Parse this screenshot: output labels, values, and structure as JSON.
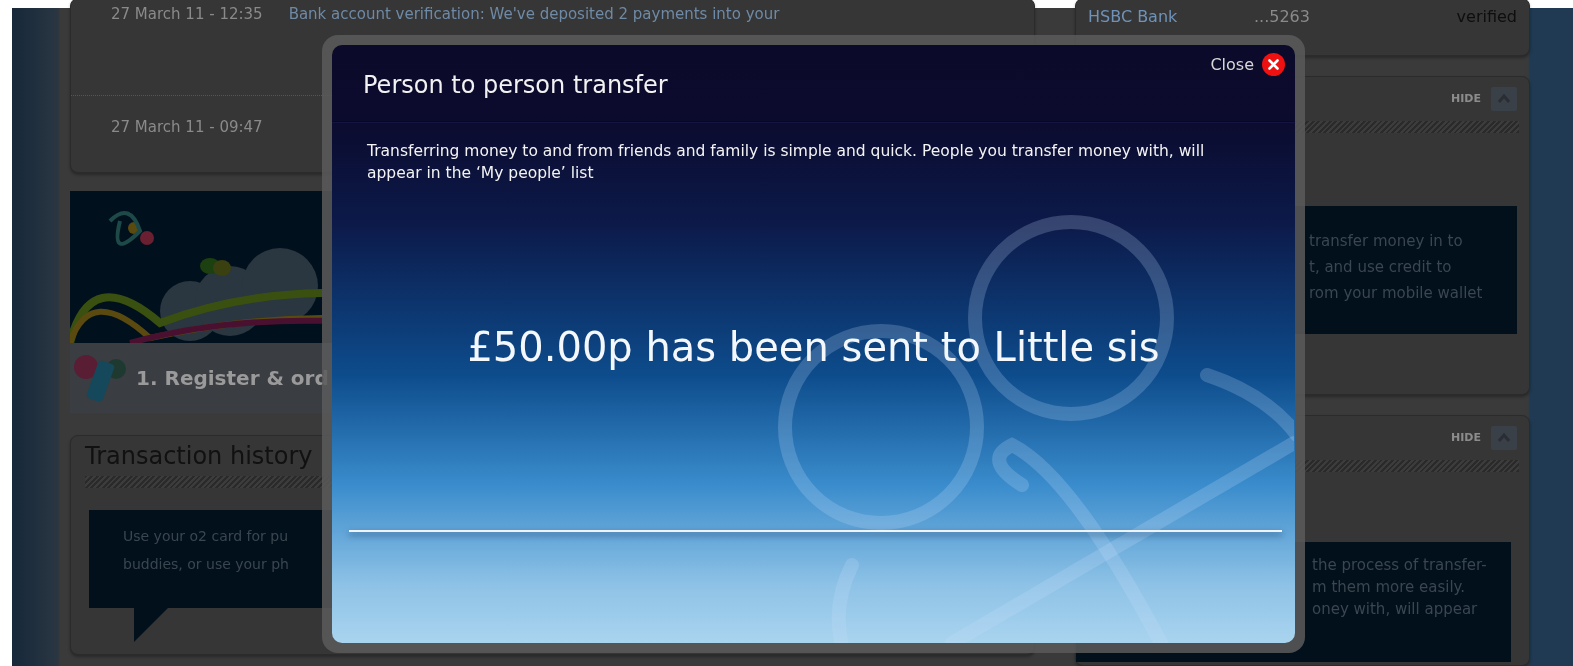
{
  "notifications": [
    {
      "time": "27 March 11 - 12:35",
      "message": "Bank account verification: We've deposited 2 payments into your"
    },
    {
      "time": "27 March 11 - 09:47"
    }
  ],
  "banner": {
    "step": "1. Register & ord"
  },
  "transaction_history": {
    "title": "Transaction history",
    "callout": [
      "Use your o2 card for pu",
      "buddies, or use your ph"
    ]
  },
  "bank_account": {
    "name": "HSBC Bank",
    "number": "...5263",
    "status": "verified"
  },
  "side_panels": [
    {
      "hide": "HIDE",
      "callout": [
        "transfer money in to",
        "t, and use credit to",
        "rom your mobile wallet"
      ]
    },
    {
      "hide": "HIDE",
      "callout": [
        "the process of transfer-",
        "m them more easily.",
        "oney with, will appear"
      ]
    }
  ],
  "dialog": {
    "title": "Person to person transfer",
    "close": "Close",
    "intro": "Transferring money to and from friends and family is simple and quick.  People you transfer money with, will appear in the ‘My people’ list",
    "message": "£50.00p has been sent to Little sis"
  }
}
